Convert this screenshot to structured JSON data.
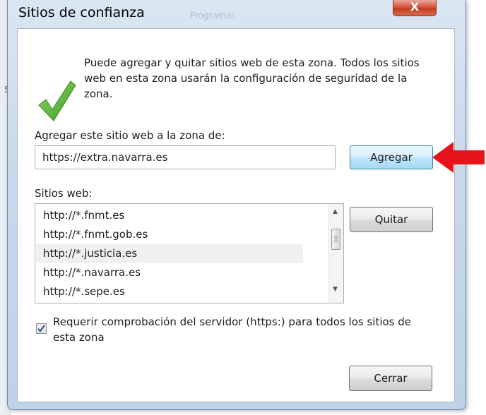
{
  "dialog": {
    "title": "Sitios de confianza",
    "close_label": "X",
    "background_tab_label": "Programas",
    "intro_text": "Puede agregar y quitar sitios web de esta zona. Todos los sitios web en esta zona usarán la configuración de seguridad de la zona.",
    "add_field_label": "Agregar este sitio web a la zona de:",
    "url_input_value": "https://extra.navarra.es",
    "add_button_label": "Agregar",
    "websites_label": "Sitios web:",
    "websites": [
      "http://*.fnmt.es",
      "http://*.fnmt.gob.es",
      "http://*.justicia.es",
      "http://*.navarra.es",
      "http://*.sepe.es"
    ],
    "remove_button_label": "Quitar",
    "require_https_label": "Requerir comprobación del servidor (https:) para todos los sitios de esta zona",
    "require_https_checked": true,
    "close_button_label": "Cerrar"
  },
  "colors": {
    "check_green": "#5cb53a",
    "annotation_red": "#e8141b",
    "focused_button": "#a7d9f5"
  },
  "background_window": {
    "partial_text": "S"
  }
}
